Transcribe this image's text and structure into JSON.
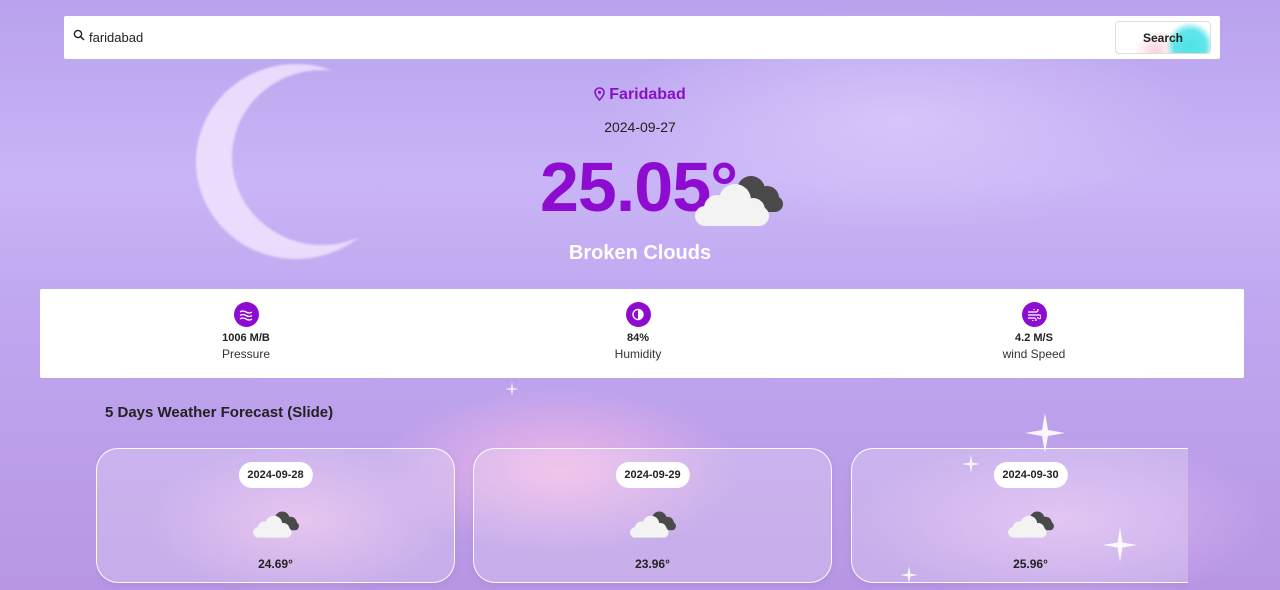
{
  "search": {
    "value": "faridabad",
    "button_label": "Search"
  },
  "current": {
    "location": "Faridabad",
    "date": "2024-09-27",
    "temperature": "25.05°",
    "condition": "Broken Clouds",
    "icon": "broken-clouds-icon"
  },
  "stats": [
    {
      "value": "1006 M/B",
      "label": "Pressure",
      "icon": "waves-icon"
    },
    {
      "value": "84%",
      "label": "Humidity",
      "icon": "droplet-icon"
    },
    {
      "value": "4.2 M/S",
      "label": "wind Speed",
      "icon": "wind-icon"
    }
  ],
  "forecast": {
    "title": "5 Days Weather Forecast (Slide)",
    "days": [
      {
        "date": "2024-09-28",
        "temp": "24.69°",
        "icon": "broken-clouds-icon"
      },
      {
        "date": "2024-09-29",
        "temp": "23.96°",
        "icon": "broken-clouds-icon"
      },
      {
        "date": "2024-09-30",
        "temp": "25.96°",
        "icon": "broken-clouds-icon"
      }
    ]
  },
  "colors": {
    "accent": "#8e0bd0",
    "location_text": "#8a10c8"
  }
}
